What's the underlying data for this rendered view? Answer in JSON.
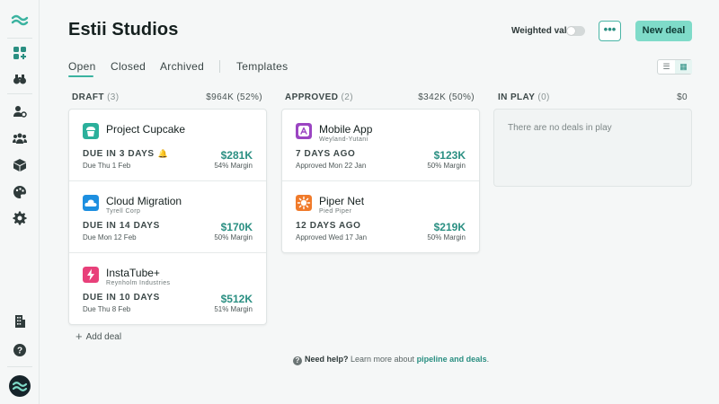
{
  "app": {
    "title": "Estii Studios"
  },
  "sidebar": {
    "icons": [
      "wave-logo-icon",
      "apps-plus-icon",
      "binoculars-icon",
      "user-settings-icon",
      "team-icon",
      "package-icon",
      "palette-icon",
      "gear-icon",
      "building-icon",
      "help-icon"
    ]
  },
  "header": {
    "weighted_value_label": "Weighted value",
    "weighted_value_on": false,
    "more_label": "•••",
    "new_deal_label": "New deal"
  },
  "tabs": [
    {
      "label": "Open",
      "active": true
    },
    {
      "label": "Closed",
      "active": false
    },
    {
      "label": "Archived",
      "active": false
    },
    {
      "label": "Templates",
      "active": false
    }
  ],
  "view_toggle": {
    "active": "board"
  },
  "columns": [
    {
      "title": "DRAFT",
      "count": "(3)",
      "total": "$964K (52%)",
      "deals": [
        {
          "name": "Project Cupcake",
          "client": "",
          "due": "DUE IN 3 DAYS",
          "date": "Due Thu 1 Feb",
          "value": "$281K",
          "margin": "54% Margin",
          "icon": "cupcake-icon",
          "color": "#2bb09b",
          "bell": true
        },
        {
          "name": "Cloud Migration",
          "client": "Tyrell Corp",
          "due": "DUE IN 14 DAYS",
          "date": "Due Mon 12 Feb",
          "value": "$170K",
          "margin": "50% Margin",
          "icon": "cloud-icon",
          "color": "#1d8fe0",
          "bell": false
        },
        {
          "name": "InstaTube+",
          "client": "Reynholm Industries",
          "due": "DUE IN 10 DAYS",
          "date": "Due Thu 8 Feb",
          "value": "$512K",
          "margin": "51% Margin",
          "icon": "bolt-icon",
          "color": "#e8407a",
          "bell": false
        }
      ]
    },
    {
      "title": "APPROVED",
      "count": "(2)",
      "total": "$342K (50%)",
      "deals": [
        {
          "name": "Mobile App",
          "client": "Weyland-Yutani",
          "due": "7 DAYS AGO",
          "date": "Approved Mon 22 Jan",
          "value": "$123K",
          "margin": "50% Margin",
          "icon": "app-store-icon",
          "color": "#9b45c2",
          "bell": false
        },
        {
          "name": "Piper Net",
          "client": "Pied Piper",
          "due": "12 DAYS AGO",
          "date": "Approved Wed 17 Jan",
          "value": "$219K",
          "margin": "50% Margin",
          "icon": "sun-icon",
          "color": "#f07a2a",
          "bell": false
        }
      ]
    },
    {
      "title": "IN PLAY",
      "count": "(0)",
      "total": "$0",
      "empty_text": "There are no deals in play",
      "deals": []
    }
  ],
  "add_deal_label": "Add deal",
  "help": {
    "lead": "Need help?",
    "text": " Learn more about ",
    "link": "pipeline and deals",
    "end": "."
  }
}
